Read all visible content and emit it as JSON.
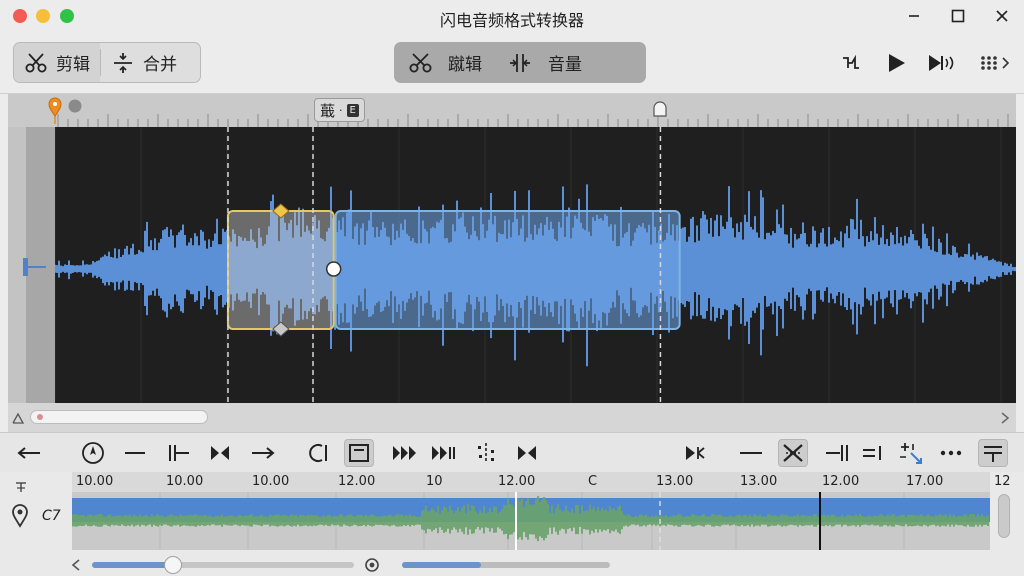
{
  "window": {
    "title": "闪电音频格式转换器"
  },
  "toolbar": {
    "left_segment": [
      {
        "label": "剪辑",
        "icon": "scissors-icon"
      },
      {
        "label": "合并",
        "icon": "merge-icon"
      }
    ],
    "center_segment": [
      {
        "label": "蹴辑",
        "icon": "scissors-icon"
      },
      {
        "label": "音量",
        "icon": "volume-adjust-icon"
      }
    ],
    "right_icons": [
      "split-channel-icon",
      "play-icon",
      "play-audio-icon",
      "more-icon"
    ]
  },
  "waveform": {
    "region_label": "蕺",
    "region_tag": "E",
    "selection": {
      "start_fraction": 0.18,
      "end_fraction": 0.29
    },
    "region2": {
      "start_fraction": 0.29,
      "end_fraction": 0.65
    },
    "playhead_fraction": 0.63,
    "colors": {
      "wave": "#5b8fd6",
      "selection_border": "#e3c86a",
      "region_border": "#7fb4e6",
      "background": "#1f1f1f"
    }
  },
  "transport": {
    "buttons": [
      "arrow-left-icon",
      "compass-icon",
      "dash-icon",
      "split-marker-icon",
      "trim-icon",
      "arrow-right-icon",
      "loop-icon",
      "crop-frame-icon",
      "fast-forward-icon",
      "skip-forward-icon",
      "scatter-icon",
      "bowtie-icon",
      "speaker-fork-icon",
      "minus-icon",
      "mute-cross-icon",
      "end-marker-icon",
      "equals-marker-icon",
      "sparkle-add-icon",
      "dots-icon",
      "align-icon"
    ],
    "pressed": [
      "crop-frame-icon",
      "mute-cross-icon",
      "align-icon"
    ]
  },
  "timeline": {
    "track_name": "C7",
    "time_labels": [
      "10.00",
      "10.00",
      "10.00",
      "12.00",
      "10",
      "12.00",
      "C",
      "13.00",
      "13.00",
      "12.00",
      "17.00",
      "12"
    ],
    "colors": {
      "wave_blue": "#4f86cf",
      "wave_green": "#6aa36b"
    }
  },
  "zoom": {
    "slider_fraction": 0.31,
    "progress_fraction": 0.38
  }
}
